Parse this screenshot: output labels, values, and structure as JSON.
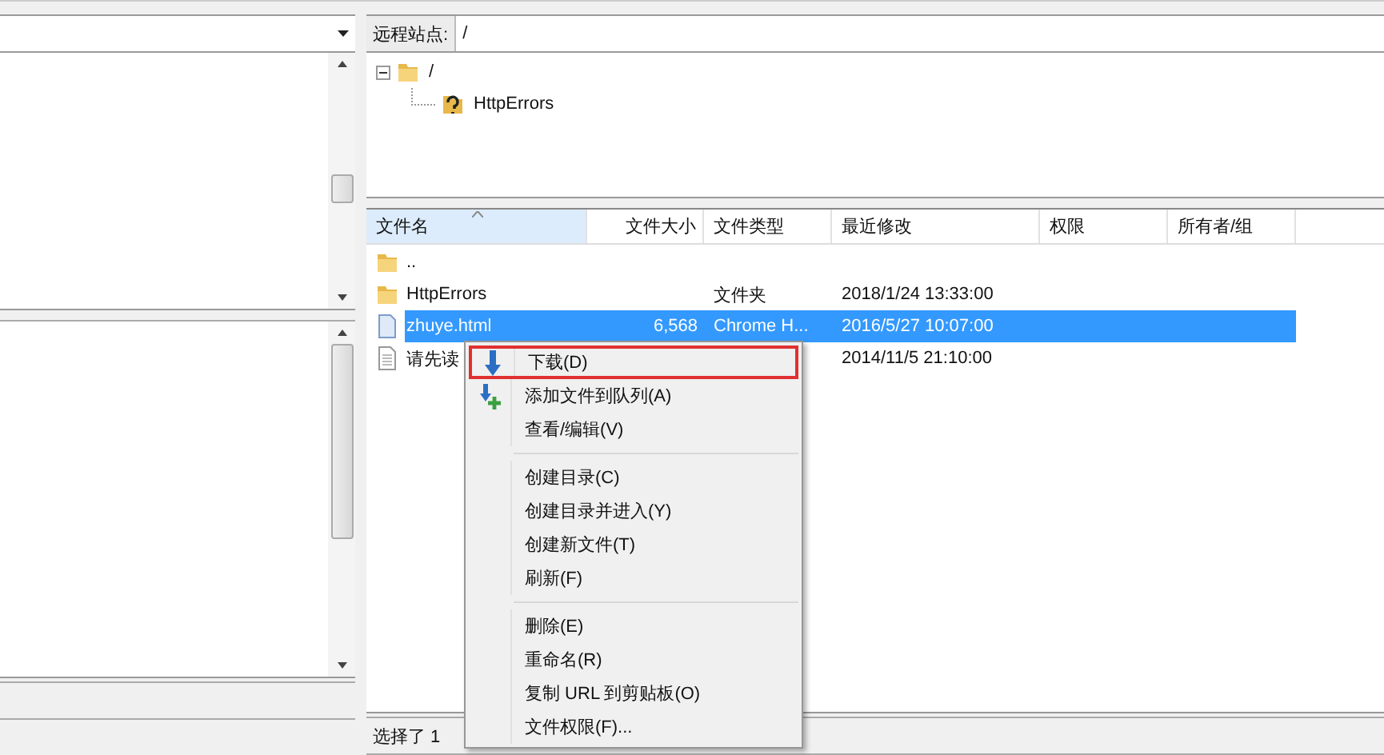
{
  "remote": {
    "path": {
      "label": "远程站点:",
      "value": "/"
    },
    "tree": [
      {
        "label": "/",
        "kind": "folder",
        "expanded": true,
        "children": [
          {
            "label": "HttpErrors",
            "kind": "unknown"
          }
        ]
      }
    ],
    "columns": [
      "文件名",
      "文件大小",
      "文件类型",
      "最近修改",
      "权限",
      "所有者/组"
    ],
    "rows": [
      {
        "kind": "folder",
        "cells": [
          ".."
        ],
        "selected": false
      },
      {
        "kind": "folder",
        "cells": [
          "HttpErrors",
          "",
          "文件夹",
          "2018/1/24 13:33:00"
        ],
        "selected": false
      },
      {
        "kind": "file",
        "cells": [
          "zhuye.html",
          "6,568",
          "Chrome H...",
          "2016/5/27 10:07:00"
        ],
        "selected": true
      },
      {
        "kind": "document",
        "cells": [
          "请先读",
          "",
          "",
          "2014/11/5 21:10:00"
        ],
        "selected": false
      }
    ],
    "status_bar": "选择了 1"
  },
  "context_menu": [
    {
      "kind": "download",
      "label": "下载(D)",
      "outlined": true
    },
    {
      "kind": "queue",
      "label": "添加文件到队列(A)",
      "outlined": false
    },
    {
      "kind": "plain",
      "label": "查看/编辑(V)",
      "outlined": false
    },
    {
      "kind": "separator"
    },
    {
      "kind": "plain",
      "label": "创建目录(C)",
      "outlined": false
    },
    {
      "kind": "plain",
      "label": "创建目录并进入(Y)",
      "outlined": false
    },
    {
      "kind": "plain",
      "label": "创建新文件(T)",
      "outlined": false
    },
    {
      "kind": "plain",
      "label": "刷新(F)",
      "outlined": false
    },
    {
      "kind": "separator"
    },
    {
      "kind": "plain",
      "label": "删除(E)",
      "outlined": false
    },
    {
      "kind": "plain",
      "label": "重命名(R)",
      "outlined": false
    },
    {
      "kind": "plain",
      "label": "复制 URL 到剪贴板(O)",
      "outlined": false
    },
    {
      "kind": "plain",
      "label": "文件权限(F)...",
      "outlined": false
    }
  ]
}
